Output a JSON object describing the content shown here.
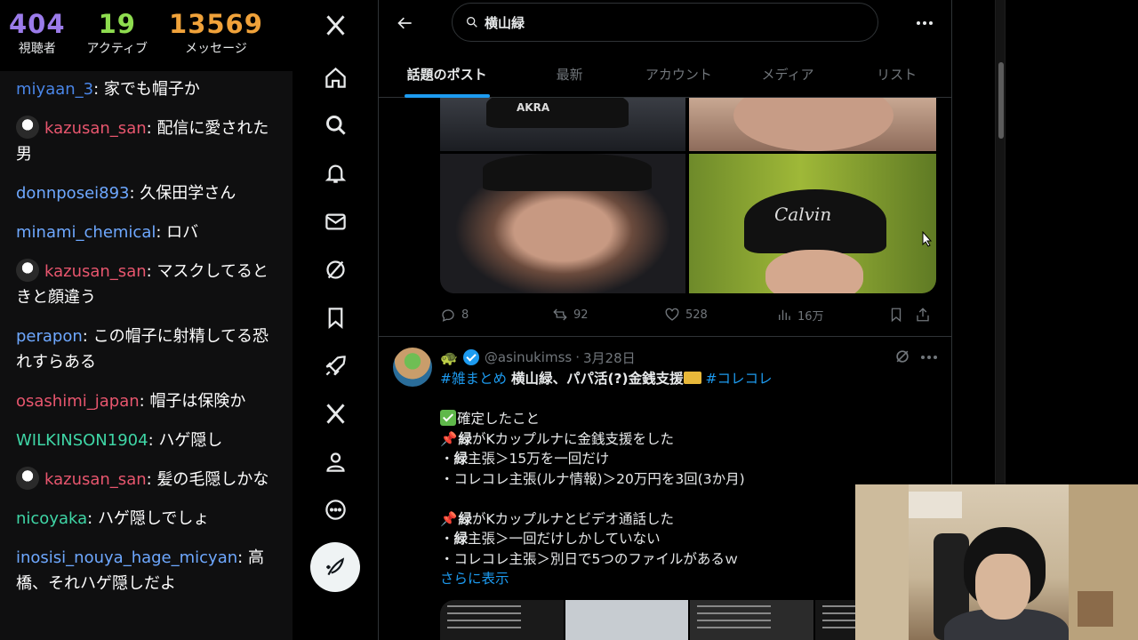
{
  "stats": [
    {
      "value": "404",
      "label": "視聴者",
      "color": "#9b7bea"
    },
    {
      "value": "19",
      "label": "アクティブ",
      "color": "#8edc4f"
    },
    {
      "value": "13569",
      "label": "メッセージ",
      "color": "#f0a23a"
    }
  ],
  "chat": [
    {
      "user": "miyaan_3",
      "color": "#4a86e8",
      "text": "家でも帽子か",
      "avatar": false
    },
    {
      "user": "kazusan_san",
      "color": "#e8566e",
      "text": "配信に愛された男",
      "avatar": true
    },
    {
      "user": "donnposei893",
      "color": "#6ea8ff",
      "text": "久保田学さん",
      "avatar": false
    },
    {
      "user": "minami_chemical",
      "color": "#6ea8ff",
      "text": "ロバ",
      "avatar": false
    },
    {
      "user": "kazusan_san",
      "color": "#e8566e",
      "text": "マスクしてるときと顔違う",
      "avatar": true
    },
    {
      "user": "perapon",
      "color": "#6ea8ff",
      "text": "この帽子に射精してる恐れすらある",
      "avatar": false
    },
    {
      "user": "osashimi_japan",
      "color": "#e8566e",
      "text": "帽子は保険か",
      "avatar": false
    },
    {
      "user": "WILKINSON1904",
      "color": "#3fd6a6",
      "text": "ハゲ隠し",
      "avatar": false
    },
    {
      "user": "kazusan_san",
      "color": "#e8566e",
      "text": "髪の毛隠しかな",
      "avatar": true
    },
    {
      "user": "nicoyaka",
      "color": "#3fd6a6",
      "text": "ハゲ隠しでしょ",
      "avatar": false
    },
    {
      "user": "inosisi_nouya_hage_micyan",
      "color": "#6ea8ff",
      "text": "高橋、それハゲ隠しだよ",
      "avatar": false
    }
  ],
  "nav": [
    "x-logo-icon",
    "home-icon",
    "search-icon",
    "bell-icon",
    "mail-icon",
    "grok-icon",
    "bookmark-icon",
    "rocket-icon",
    "x-premium-icon",
    "profile-icon",
    "more-circle-icon",
    "post-feather-icon"
  ],
  "search": {
    "query": "横山緑"
  },
  "tabs": [
    "話題のポスト",
    "最新",
    "アカウント",
    "メディア",
    "リスト"
  ],
  "post1": {
    "image_texts": {
      "cap1": "AKRA",
      "cap4": "Calvin"
    },
    "replies": "8",
    "reposts": "92",
    "likes": "528",
    "views": "16万"
  },
  "post2": {
    "handle": "@asinukimss",
    "dot": "·",
    "date": "3月28日",
    "line1_tag1": "#雑まとめ",
    "line1_text": "横山緑、パパ活(?)金銭支援",
    "line1_tag2": "#コレコレ",
    "confirmed": "確定したこと",
    "l1_bold": "緑",
    "l1_text": "がKカップルナに金銭支援をした",
    "l2_pre": "・",
    "l2_bold": "緑",
    "l2_text": "主張＞15万を一回だけ",
    "l3": "・コレコレ主張(ルナ情報)＞20万円を3回(3か月)",
    "l4_bold": "緑",
    "l4_text": "がKカップルナとビデオ通話した",
    "l5_pre": "・",
    "l5_bold": "緑",
    "l5_text": "主張＞一回だけしかしていない",
    "l6": "・コレコレ主張＞別日で5つのファイルがあるｗ",
    "show_more": "さらに表示"
  },
  "colors": {
    "accent": "#1d9bf0",
    "border": "#2f3336",
    "muted": "#71767b"
  }
}
